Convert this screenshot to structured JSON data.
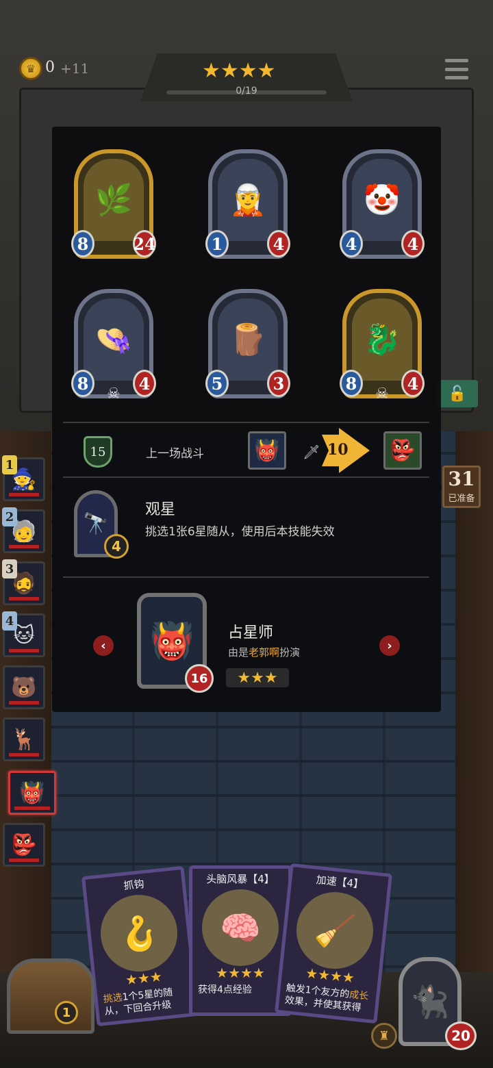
{
  "header": {
    "gold": "0",
    "gold_income": "+11",
    "tier_stars": "★★★★",
    "xp": "0/19"
  },
  "overlay": {
    "cards": [
      {
        "attack": "8",
        "health": "24",
        "golden": true,
        "skull": false,
        "art": "🌿"
      },
      {
        "attack": "1",
        "health": "4",
        "golden": false,
        "skull": false,
        "art": "🧝"
      },
      {
        "attack": "4",
        "health": "4",
        "golden": false,
        "skull": false,
        "art": "🤡"
      },
      {
        "attack": "8",
        "health": "4",
        "golden": false,
        "skull": true,
        "art": "👒"
      },
      {
        "attack": "5",
        "health": "3",
        "golden": false,
        "skull": false,
        "art": "🪵"
      },
      {
        "attack": "8",
        "health": "4",
        "golden": true,
        "skull": true,
        "art": "🐉"
      }
    ],
    "last_battle": {
      "turn": "15",
      "label": "上一场战斗",
      "damage": "10",
      "attacker_art": "👹",
      "defender_art": "👺"
    },
    "skill": {
      "name": "观星",
      "description": "挑选1张6星随从，使用后本技能失效",
      "cost": "4",
      "art": "🔭"
    },
    "hero": {
      "name": "占星师",
      "by_prefix": "由是",
      "by_player": "老郭啊",
      "by_suffix": "扮演",
      "health": "16",
      "stars": "★★★",
      "art": "👹"
    }
  },
  "right_panel": {
    "ready_count": "31",
    "ready_label": "已准备"
  },
  "roster": [
    {
      "num": "1",
      "art": "🧙",
      "num_color": "#e8c94a"
    },
    {
      "num": "2",
      "art": "🧓",
      "num_color": "#9bb7d6"
    },
    {
      "num": "3",
      "art": "🧔",
      "num_color": "#d8d0c0"
    },
    {
      "num": "4",
      "art": "🐱",
      "num_color": "#9bb7d6"
    },
    {
      "num": "",
      "art": "🐻",
      "num_color": ""
    },
    {
      "num": "",
      "art": "🦌",
      "num_color": ""
    },
    {
      "num": "",
      "art": "👹",
      "num_color": ""
    },
    {
      "num": "",
      "art": "👺",
      "num_color": ""
    }
  ],
  "spells": [
    {
      "title": "抓钩",
      "art": "🪝",
      "stars": "★★★",
      "desc_pre": "",
      "desc_hl": "挑选",
      "desc_post": "1个5星的随从，下回合升级"
    },
    {
      "title": "头脑风暴【4】",
      "art": "🧠",
      "stars": "★★★★",
      "desc_pre": "获得4点经验",
      "desc_hl": "",
      "desc_post": ""
    },
    {
      "title": "加速【4】",
      "art": "🧹",
      "stars": "★★★★",
      "desc_pre": "触发1个友方的",
      "desc_hl": "成长",
      "desc_post": "效果，并使其获得"
    }
  ],
  "bottom": {
    "chest_count": "1",
    "player_health": "20",
    "player_art": "🐈‍⬛"
  },
  "colors": {
    "gold": "#f2b830",
    "attack_gem": "#2a5a9c",
    "health_gem": "#b02424",
    "accent_orange": "#e6a93b"
  }
}
